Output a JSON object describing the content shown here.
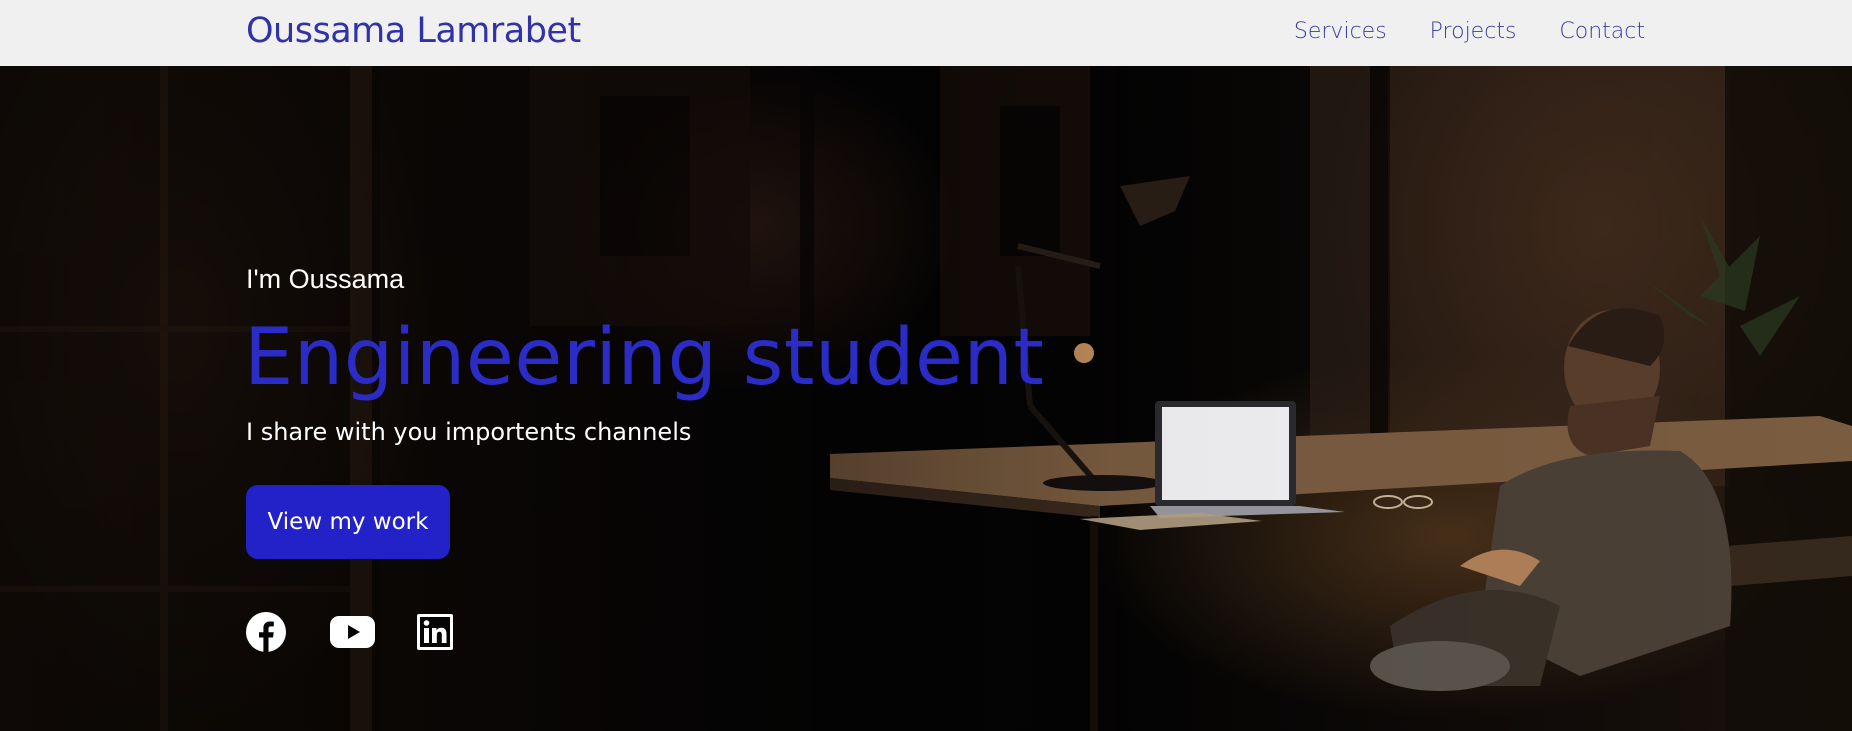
{
  "navbar": {
    "brand": "Oussama Lamrabet",
    "links": [
      "Services",
      "Projects",
      "Contact"
    ]
  },
  "hero": {
    "intro": "I'm Oussama",
    "headline": "Engineering student",
    "tagline": "I share with you importents channels",
    "cta_label": "View my work",
    "socials": [
      "facebook-icon",
      "youtube-icon",
      "linkedin-icon"
    ]
  },
  "colors": {
    "brand": "#3232a8",
    "accent": "#2222c8",
    "headline": "#2b2bc6",
    "navbar_bg": "#f0f0f0"
  }
}
